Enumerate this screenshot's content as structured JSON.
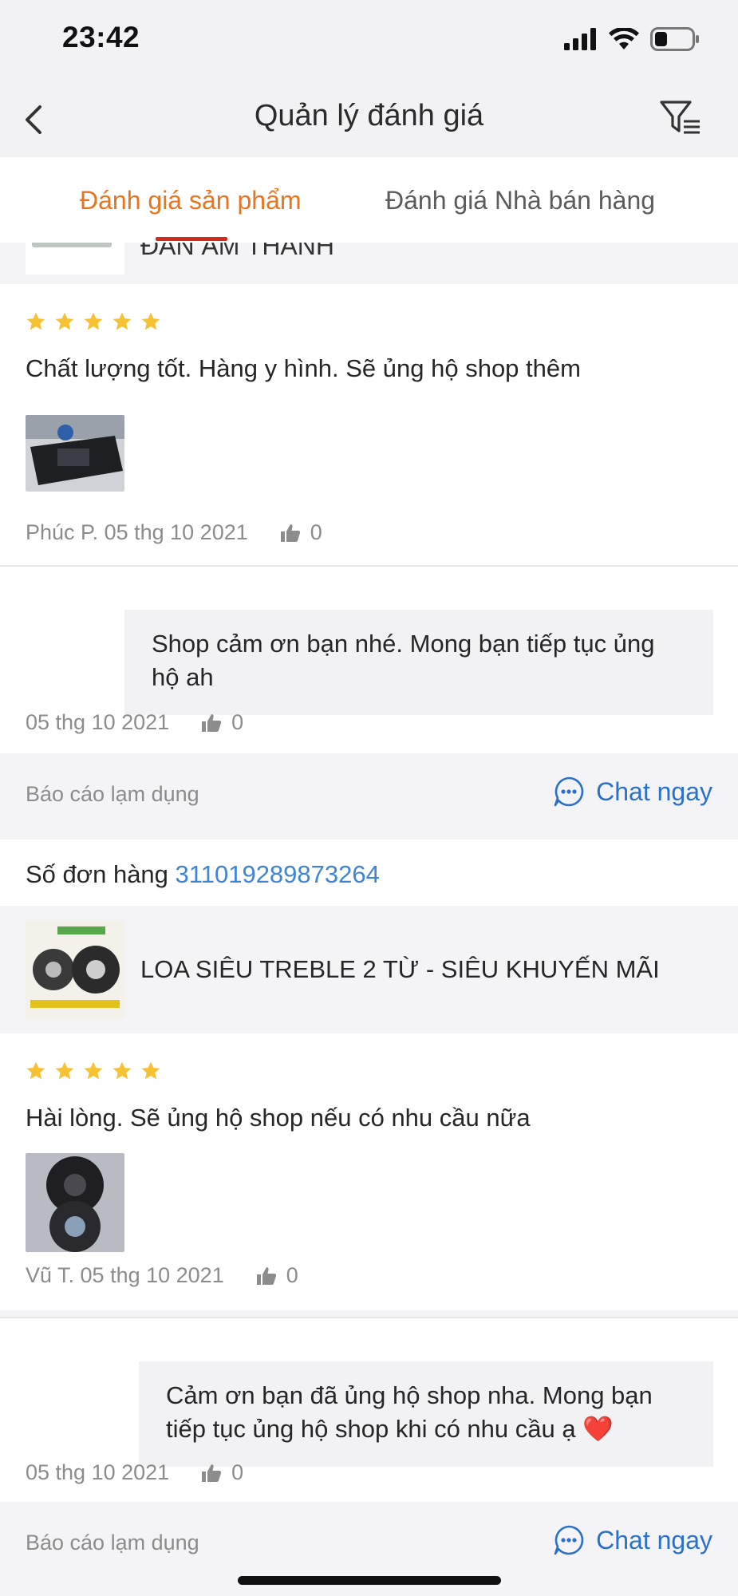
{
  "status_bar": {
    "time": "23:42"
  },
  "nav": {
    "title": "Quản lý đánh giá"
  },
  "tabs": [
    {
      "label": "Đánh giá sản phẩm",
      "active": true
    },
    {
      "label": "Đánh giá Nhà bán hàng",
      "active": false
    }
  ],
  "partial_product": {
    "name": "ĐÀN ÂM THANH"
  },
  "colors": {
    "accent": "#e8741f",
    "star": "#f6c232",
    "link": "#2a72c9",
    "tab_indicator": "#d42b1d"
  },
  "reviews": [
    {
      "rating": 5,
      "text": "Chất lượng tốt. Hàng y hình. Sẽ ủng hộ shop thêm",
      "author_date": "Phúc P. 05 thg 10 2021",
      "likes": "0",
      "reply": {
        "text": "Shop cảm ơn bạn nhé. Mong bạn tiếp tục ủng hộ ah",
        "date": "05 thg 10 2021",
        "likes": "0"
      },
      "report_label": "Báo cáo lạm dụng",
      "chat_label": "Chat ngay"
    },
    {
      "order_label": "Số đơn hàng",
      "order_number": "311019289873264",
      "product_name": "LOA SIÊU TREBLE 2 TỪ - SIÊU KHUYẾN MÃI",
      "rating": 5,
      "text": "Hài lòng. Sẽ ủng hộ shop nếu có nhu cầu nữa",
      "author_date": "Vũ T. 05 thg 10 2021",
      "likes": "0",
      "reply": {
        "text": "Cảm ơn bạn đã ủng hộ shop nha. Mong bạn tiếp tục ủng hộ shop khi có nhu cầu ạ ❤️",
        "date": "05 thg 10 2021",
        "likes": "0"
      },
      "report_label": "Báo cáo lạm dụng",
      "chat_label": "Chat ngay"
    }
  ]
}
